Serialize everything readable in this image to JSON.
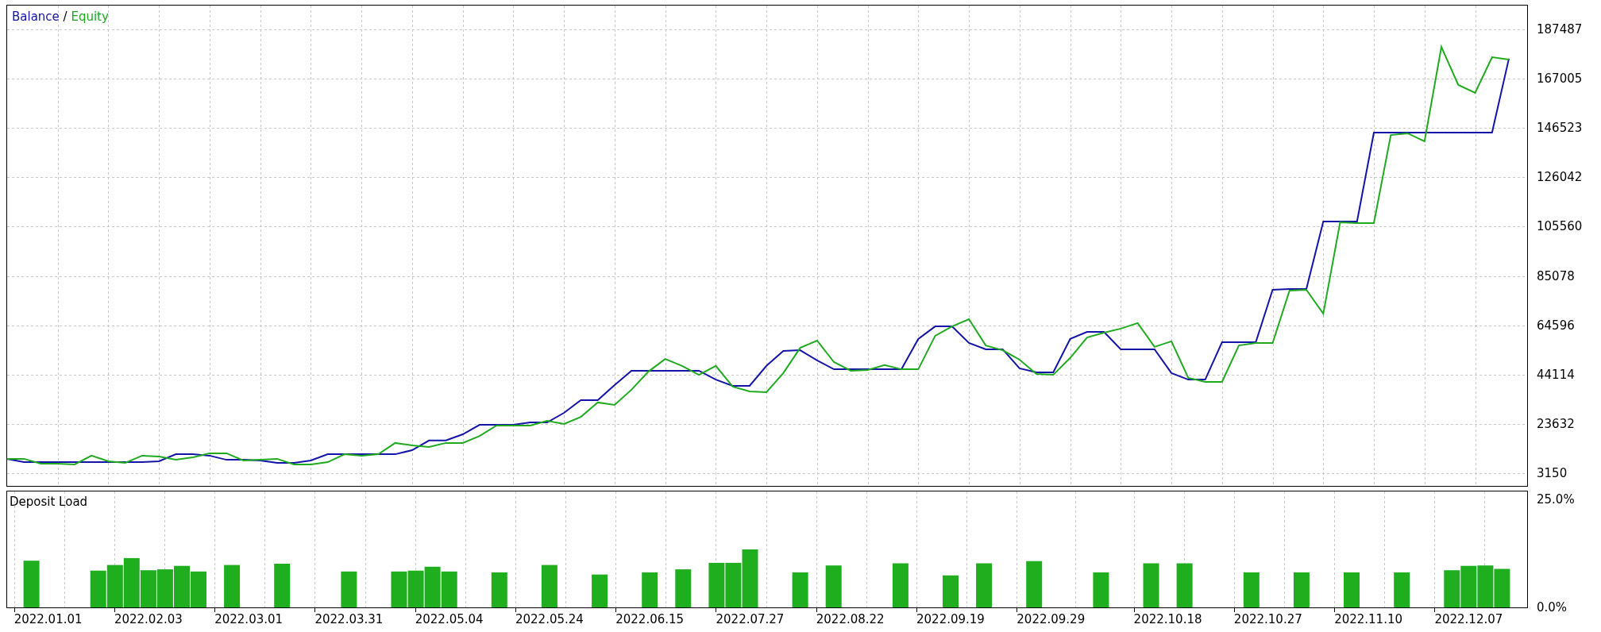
{
  "main_chart": {
    "legend_separator": "/",
    "chart_data": {
      "type": "line",
      "categories": [
        null,
        null,
        null,
        null,
        null,
        null,
        null,
        null,
        null,
        null,
        null,
        null,
        null,
        null,
        null,
        null,
        null,
        null,
        null,
        null,
        null,
        null,
        null,
        null,
        null,
        null,
        null,
        null,
        null,
        null,
        null,
        null,
        null,
        null,
        null,
        null,
        null,
        null,
        null,
        null,
        null,
        null,
        null,
        null,
        null,
        null,
        null,
        null,
        null,
        null,
        null,
        null,
        null,
        null,
        null,
        null,
        null,
        null,
        null,
        null,
        null,
        null,
        null,
        null,
        null,
        null,
        null,
        null,
        null,
        null,
        null,
        null,
        null,
        null,
        null,
        null,
        null,
        null,
        null,
        null,
        null,
        null,
        null,
        null,
        null,
        null,
        null,
        null,
        null,
        null
      ],
      "grid": true,
      "ylim": [
        -2150,
        197710
      ],
      "yticks": [
        3150,
        23632,
        44114,
        64596,
        85078,
        105560,
        126042,
        146523,
        167005,
        187487
      ],
      "series": [
        {
          "name": "Balance",
          "color": "#1414a8",
          "values": [
            9100,
            7700,
            7700,
            7700,
            7700,
            7700,
            7700,
            7700,
            7700,
            8100,
            11000,
            11000,
            10400,
            8700,
            8700,
            8400,
            7400,
            7400,
            8400,
            11000,
            11000,
            11000,
            11000,
            11000,
            12700,
            16700,
            16700,
            19300,
            23200,
            23200,
            23200,
            24200,
            24200,
            28200,
            33500,
            33500,
            39700,
            45700,
            45700,
            45700,
            45700,
            45700,
            42000,
            39400,
            39400,
            47700,
            53900,
            54200,
            50000,
            46300,
            46300,
            46300,
            46300,
            46300,
            58900,
            64100,
            64100,
            57200,
            54600,
            54600,
            46700,
            45000,
            45000,
            58900,
            61800,
            61800,
            54600,
            54600,
            54600,
            44700,
            42000,
            42000,
            57500,
            57500,
            57500,
            79300,
            79600,
            79600,
            107700,
            107700,
            107700,
            144600,
            144600,
            144600,
            144600,
            144600,
            144600,
            144600,
            144600,
            175300
          ]
        },
        {
          "name": "Equity",
          "color": "#1faa1f",
          "values": [
            9100,
            9100,
            7100,
            7100,
            6800,
            10400,
            8100,
            7400,
            10400,
            10100,
            8700,
            9700,
            11400,
            11400,
            8400,
            8700,
            9100,
            6800,
            6800,
            7700,
            11000,
            10400,
            11000,
            15700,
            14700,
            14000,
            15700,
            15700,
            18600,
            22900,
            22900,
            22900,
            24900,
            23600,
            26500,
            32500,
            31500,
            37800,
            45300,
            50600,
            47700,
            44000,
            47700,
            39100,
            37100,
            36800,
            44700,
            55200,
            58200,
            49300,
            45700,
            46000,
            48000,
            46300,
            46300,
            60200,
            64100,
            67100,
            56200,
            54200,
            50300,
            44400,
            44000,
            51000,
            59500,
            61500,
            63200,
            65500,
            55600,
            57900,
            42700,
            41100,
            41100,
            56200,
            57200,
            57200,
            79000,
            79300,
            69400,
            107300,
            107000,
            107000,
            143600,
            144300,
            141000,
            180200,
            164400,
            161100,
            175900,
            175000
          ]
        }
      ]
    }
  },
  "deposit_chart": {
    "chart_data": {
      "type": "bar",
      "title": "Deposit Load",
      "categories": [
        null,
        null,
        "2022.01.01",
        null,
        null,
        null,
        null,
        null,
        "2022.02.03",
        null,
        null,
        null,
        null,
        null,
        "2022.03.01",
        null,
        null,
        null,
        null,
        null,
        "2022.03.31",
        null,
        null,
        null,
        null,
        null,
        "2022.05.04",
        null,
        null,
        null,
        null,
        null,
        "2022.05.24",
        null,
        null,
        null,
        null,
        null,
        "2022.06.15",
        null,
        null,
        null,
        null,
        null,
        "2022.07.27",
        null,
        null,
        null,
        null,
        null,
        "2022.08.22",
        null,
        null,
        null,
        null,
        null,
        "2022.09.19",
        null,
        null,
        null,
        null,
        null,
        "2022.09.29",
        null,
        null,
        null,
        null,
        null,
        null,
        "2022.10.18",
        null,
        null,
        null,
        null,
        null,
        "2022.10.27",
        null,
        null,
        null,
        null,
        null,
        "2022.11.10",
        null,
        null,
        null,
        null,
        null,
        "2022.12.07",
        null,
        null,
        null
      ],
      "series": [
        {
          "color": "#1eae1e",
          "values": [
            null,
            10.8,
            null,
            null,
            null,
            8.5,
            9.8,
            11.4,
            8.6,
            8.8,
            9.6,
            8.3,
            null,
            9.8,
            null,
            null,
            10.1,
            null,
            null,
            null,
            8.3,
            null,
            null,
            8.3,
            8.5,
            9.4,
            8.3,
            null,
            null,
            8.1,
            null,
            null,
            9.8,
            null,
            null,
            7.6,
            null,
            null,
            8.1,
            null,
            8.8,
            null,
            10.3,
            10.3,
            13.4,
            null,
            null,
            8.1,
            null,
            9.7,
            null,
            null,
            null,
            10.2,
            null,
            null,
            7.4,
            null,
            10.2,
            null,
            null,
            10.7,
            null,
            null,
            null,
            8.1,
            null,
            null,
            10.2,
            null,
            10.2,
            null,
            null,
            null,
            8.1,
            null,
            null,
            8.1,
            null,
            null,
            8.1,
            null,
            null,
            8.1,
            null,
            null,
            8.6,
            9.6,
            9.7,
            8.9,
            null
          ]
        }
      ],
      "grid": true,
      "ylim": [
        0,
        27
      ],
      "yticks": [
        {
          "value": 0,
          "label": "0.0%"
        },
        {
          "value": 25,
          "label": "25.0%"
        }
      ]
    }
  }
}
